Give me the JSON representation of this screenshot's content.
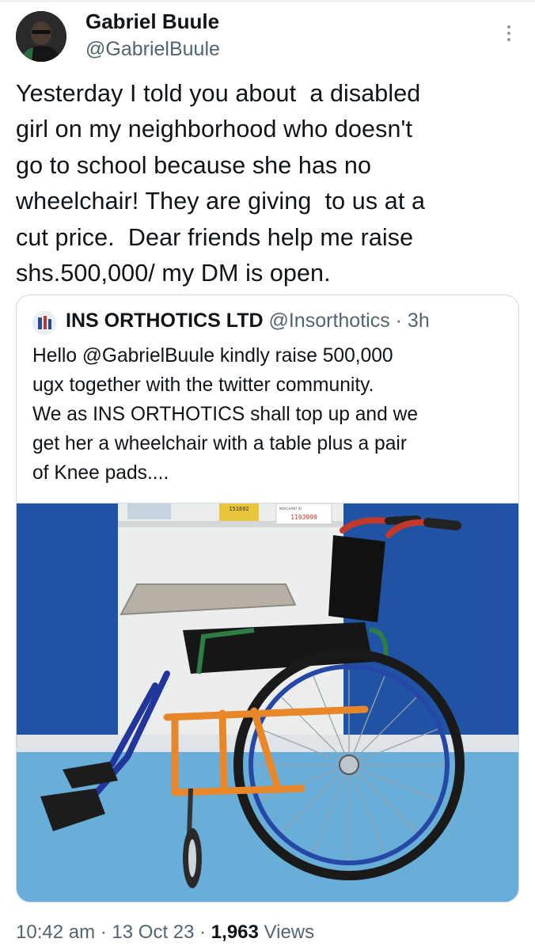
{
  "author": {
    "name": "Gabriel Buule",
    "handle": "@GabrielBuule"
  },
  "tweet": {
    "lines": [
      "Yesterday I told you about  a disabled",
      "girl on my neighborhood who doesn't",
      "go to school because she has no",
      "wheelchair! They are giving  to us at a",
      "cut price.  Dear friends help me raise",
      "shs.500,000/ my DM is open."
    ]
  },
  "quote": {
    "name": "INS ORTHOTICS LTD",
    "handle": "@Insorthotics",
    "separator": " · ",
    "time": "3h",
    "lines": [
      "Hello @GabrielBuule kindly raise 500,000",
      "ugx together with the twitter community.",
      "We as INS ORTHOTICS shall top up and we",
      "get her a wheelchair with a table plus a pair",
      "of Knee pads...."
    ],
    "media": {
      "kind": "photo of a wheelchair with a lap table",
      "tag1": "151692",
      "tag2": "1193999",
      "tag2_label": "MERCHANT ID"
    }
  },
  "meta": {
    "time": "10:42 am",
    "separator": " · ",
    "date": "13 Oct 23",
    "views_count": "1,963",
    "views_label": "Views"
  },
  "colors": {
    "text": "#0f1419",
    "secondary": "#536471",
    "border": "#cfd9de",
    "wall_blue": "#1d4fa0",
    "floor_blue": "#5ea6d4",
    "frame_orange": "#e8862a"
  }
}
